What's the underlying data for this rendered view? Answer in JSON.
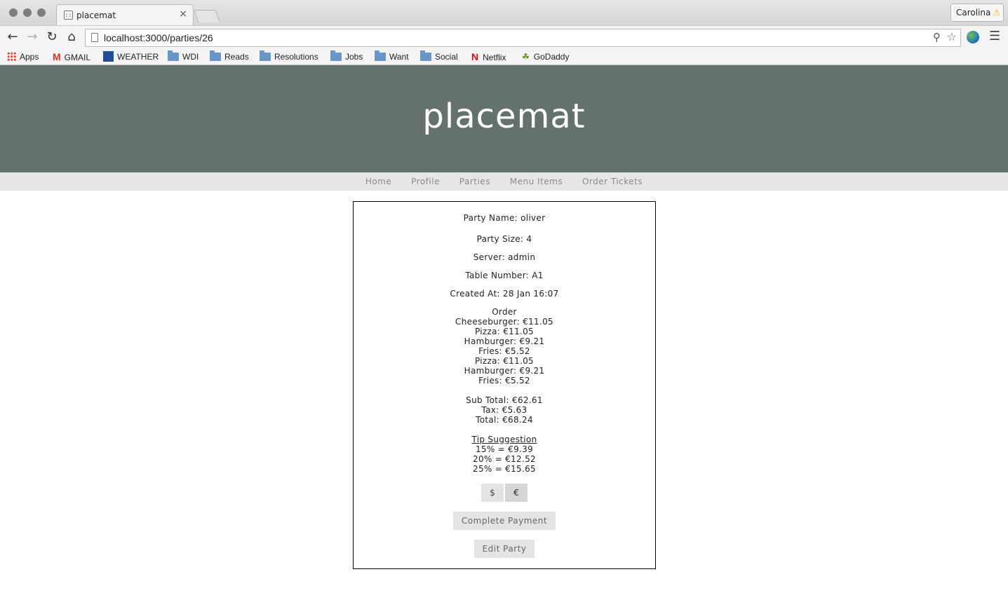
{
  "browser": {
    "tab_title": "placemat",
    "tab_close": "×",
    "profile_name": "Carolina",
    "profile_warning": "⚠",
    "url": "localhost:3000/parties/26",
    "bookmarks": [
      {
        "label": "Apps",
        "icon": "apps-grid-icon"
      },
      {
        "label": "GMAIL",
        "icon": "gmail-icon"
      },
      {
        "label": "WEATHER",
        "icon": "weather-icon"
      },
      {
        "label": "WDI",
        "icon": "folder-icon"
      },
      {
        "label": "Reads",
        "icon": "folder-icon"
      },
      {
        "label": "Resolutions",
        "icon": "folder-icon"
      },
      {
        "label": "Jobs",
        "icon": "folder-icon"
      },
      {
        "label": "Want",
        "icon": "folder-icon"
      },
      {
        "label": "Social",
        "icon": "folder-icon"
      },
      {
        "label": "Netflix",
        "icon": "netflix-icon"
      },
      {
        "label": "GoDaddy",
        "icon": "godaddy-icon"
      }
    ]
  },
  "site": {
    "logo": "placemat",
    "nav": [
      "Home",
      "Profile",
      "Parties",
      "Menu Items",
      "Order Tickets"
    ]
  },
  "party": {
    "name": "Party Name: oliver",
    "size": "Party Size: 4",
    "server": "Server: admin",
    "table": "Table Number: A1",
    "created": "Created At: 28 Jan 16:07",
    "order_title": "Order",
    "order_items": [
      "Cheeseburger: €11.05",
      "Pizza: €11.05",
      "Hamburger: €9.21",
      "Fries: €5.52",
      "Pizza: €11.05",
      "Hamburger: €9.21",
      "Fries: €5.52"
    ],
    "subtotal": "Sub Total: €62.61",
    "tax": "Tax: €5.63",
    "total": "Total: €68.24",
    "tip_title": "Tip Suggestion",
    "tips": [
      "15% = €9.39",
      "20% = €12.52",
      "25% = €15.65"
    ],
    "currency_usd": "$",
    "currency_eur": "€",
    "complete_payment": "Complete Payment",
    "edit_party": "Edit Party"
  }
}
